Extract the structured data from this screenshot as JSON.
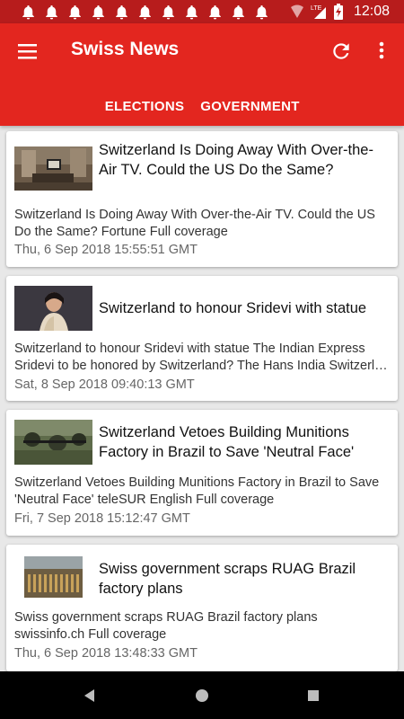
{
  "status_bar": {
    "notification_icon": "bell-icon",
    "notification_count": 11,
    "time": "12:08",
    "network": "LTE"
  },
  "app_bar": {
    "title": "Swiss News",
    "background": "#e3261f"
  },
  "tabs": [
    {
      "label": "ELECTIONS",
      "selected": false
    },
    {
      "label": "GOVERNMENT",
      "selected": true
    }
  ],
  "articles": [
    {
      "headline": "Switzerland Is Doing Away With Over-the-Air TV. Could the US Do the Same?",
      "description": "Switzerland Is Doing Away With Over-the-Air TV. Could the US Do the Same?  Fortune  Full coverage",
      "date": "Thu, 6 Sep 2018 15:55:51 GMT"
    },
    {
      "headline": "Switzerland to honour Sridevi with statue",
      "description_line1": "Switzerland to honour Sridevi with statue  The Indian Express",
      "description_line2": "Sridevi to be honored by Switzerland?  The Hans India  Switzerland to honour Sridevi with statue",
      "date": "Sat, 8 Sep 2018 09:40:13 GMT"
    },
    {
      "headline": "Switzerland Vetoes Building Munitions Factory in Brazil to Save 'Neutral Face'",
      "description": "Switzerland Vetoes Building Munitions Factory in Brazil to Save 'Neutral Face'  teleSUR English  Full coverage",
      "date": "Fri, 7 Sep 2018 15:12:47 GMT"
    },
    {
      "headline": "Swiss government scraps RUAG Brazil factory plans",
      "description": "Swiss government scraps RUAG Brazil factory plans swissinfo.ch  Full coverage",
      "date": "Thu, 6 Sep 2018 13:48:33 GMT"
    }
  ]
}
